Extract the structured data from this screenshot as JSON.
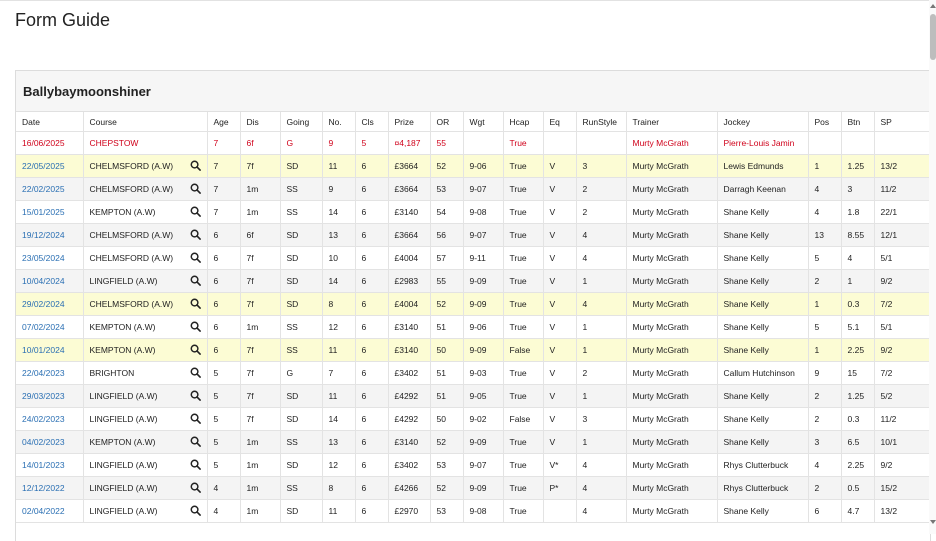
{
  "page_title": "Form Guide",
  "horse_name": "Ballybaymoonshiner",
  "columns": [
    "Date",
    "Course",
    "Age",
    "Dis",
    "Going",
    "No.",
    "Cls",
    "Prize",
    "OR",
    "Wgt",
    "Hcap",
    "Eq",
    "RunStyle",
    "Trainer",
    "Jockey",
    "Pos",
    "Btn",
    "SP"
  ],
  "rows": [
    [
      "16/06/2025",
      "CHEPSTOW",
      "7",
      "6f",
      "G",
      "9",
      "5",
      "¤4,187",
      "55",
      "",
      "True",
      "",
      "",
      "Murty McGrath",
      "Pierre-Louis Jamin",
      "",
      "",
      ""
    ],
    [
      "22/05/2025",
      "CHELMSFORD (A.W)",
      "7",
      "7f",
      "SD",
      "11",
      "6",
      "£3664",
      "52",
      "9-06",
      "True",
      "V",
      "3",
      "Murty McGrath",
      "Lewis Edmunds",
      "1",
      "1.25",
      "13/2"
    ],
    [
      "22/02/2025",
      "CHELMSFORD (A.W)",
      "7",
      "1m",
      "SS",
      "9",
      "6",
      "£3664",
      "53",
      "9-07",
      "True",
      "V",
      "2",
      "Murty McGrath",
      "Darragh Keenan",
      "4",
      "3",
      "11/2"
    ],
    [
      "15/01/2025",
      "KEMPTON (A.W)",
      "7",
      "1m",
      "SS",
      "14",
      "6",
      "£3140",
      "54",
      "9-08",
      "True",
      "V",
      "2",
      "Murty McGrath",
      "Shane Kelly",
      "4",
      "1.8",
      "22/1"
    ],
    [
      "19/12/2024",
      "CHELMSFORD (A.W)",
      "6",
      "6f",
      "SD",
      "13",
      "6",
      "£3664",
      "56",
      "9-07",
      "True",
      "V",
      "4",
      "Murty McGrath",
      "Shane Kelly",
      "13",
      "8.55",
      "12/1"
    ],
    [
      "23/05/2024",
      "CHELMSFORD (A.W)",
      "6",
      "7f",
      "SD",
      "10",
      "6",
      "£4004",
      "57",
      "9-11",
      "True",
      "V",
      "4",
      "Murty McGrath",
      "Shane Kelly",
      "5",
      "4",
      "5/1"
    ],
    [
      "10/04/2024",
      "LINGFIELD (A.W)",
      "6",
      "7f",
      "SD",
      "14",
      "6",
      "£2983",
      "55",
      "9-09",
      "True",
      "V",
      "1",
      "Murty McGrath",
      "Shane Kelly",
      "2",
      "1",
      "9/2"
    ],
    [
      "29/02/2024",
      "CHELMSFORD (A.W)",
      "6",
      "7f",
      "SD",
      "8",
      "6",
      "£4004",
      "52",
      "9-09",
      "True",
      "V",
      "4",
      "Murty McGrath",
      "Shane Kelly",
      "1",
      "0.3",
      "7/2"
    ],
    [
      "07/02/2024",
      "KEMPTON (A.W)",
      "6",
      "1m",
      "SS",
      "12",
      "6",
      "£3140",
      "51",
      "9-06",
      "True",
      "V",
      "1",
      "Murty McGrath",
      "Shane Kelly",
      "5",
      "5.1",
      "5/1"
    ],
    [
      "10/01/2024",
      "KEMPTON (A.W)",
      "6",
      "7f",
      "SS",
      "11",
      "6",
      "£3140",
      "50",
      "9-09",
      "False",
      "V",
      "1",
      "Murty McGrath",
      "Shane Kelly",
      "1",
      "2.25",
      "9/2"
    ],
    [
      "22/04/2023",
      "BRIGHTON",
      "5",
      "7f",
      "G",
      "7",
      "6",
      "£3402",
      "51",
      "9-03",
      "True",
      "V",
      "2",
      "Murty McGrath",
      "Callum Hutchinson",
      "9",
      "15",
      "7/2"
    ],
    [
      "29/03/2023",
      "LINGFIELD (A.W)",
      "5",
      "7f",
      "SD",
      "11",
      "6",
      "£4292",
      "51",
      "9-05",
      "True",
      "V",
      "1",
      "Murty McGrath",
      "Shane Kelly",
      "2",
      "1.25",
      "5/2"
    ],
    [
      "24/02/2023",
      "LINGFIELD (A.W)",
      "5",
      "7f",
      "SD",
      "14",
      "6",
      "£4292",
      "50",
      "9-02",
      "False",
      "V",
      "3",
      "Murty McGrath",
      "Shane Kelly",
      "2",
      "0.3",
      "11/2"
    ],
    [
      "04/02/2023",
      "KEMPTON (A.W)",
      "5",
      "1m",
      "SS",
      "13",
      "6",
      "£3140",
      "52",
      "9-09",
      "True",
      "V",
      "1",
      "Murty McGrath",
      "Shane Kelly",
      "3",
      "6.5",
      "10/1"
    ],
    [
      "14/01/2023",
      "LINGFIELD (A.W)",
      "5",
      "1m",
      "SD",
      "12",
      "6",
      "£3402",
      "53",
      "9-07",
      "True",
      "V*",
      "4",
      "Murty McGrath",
      "Rhys Clutterbuck",
      "4",
      "2.25",
      "9/2"
    ],
    [
      "12/12/2022",
      "LINGFIELD (A.W)",
      "4",
      "1m",
      "SS",
      "8",
      "6",
      "£4266",
      "52",
      "9-09",
      "True",
      "P*",
      "4",
      "Murty McGrath",
      "Rhys Clutterbuck",
      "2",
      "0.5",
      "15/2"
    ],
    [
      "02/04/2022",
      "LINGFIELD (A.W)",
      "4",
      "1m",
      "SD",
      "11",
      "6",
      "£2970",
      "53",
      "9-08",
      "True",
      "",
      "4",
      "Murty McGrath",
      "Shane Kelly",
      "6",
      "4.7",
      "13/2"
    ]
  ],
  "row_types": [
    "upcoming",
    "win",
    "even",
    "odd",
    "even",
    "odd",
    "even",
    "win",
    "odd",
    "win",
    "odd",
    "even",
    "odd",
    "even",
    "odd",
    "even",
    "odd"
  ],
  "colors": {
    "upcoming": "#d0021b",
    "date_link": "#2a6fb3",
    "win_highlight": "#fcfcd4"
  },
  "icons": {
    "course_action": "search-icon"
  }
}
